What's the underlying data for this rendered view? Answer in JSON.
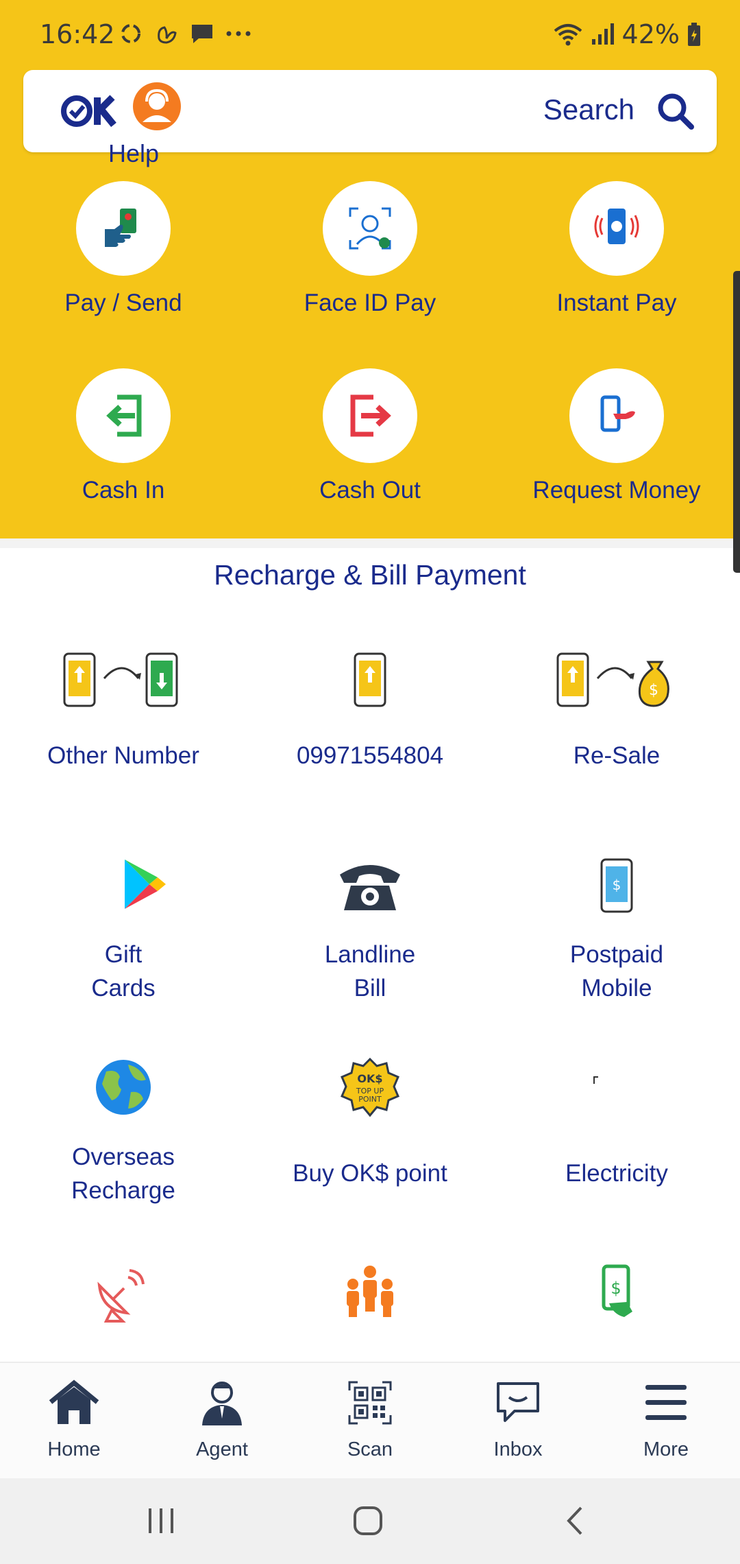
{
  "status_bar": {
    "time": "16:42",
    "battery": "42%"
  },
  "search_bar": {
    "search_label": "Search",
    "help_label": "Help"
  },
  "quick_actions": [
    {
      "label": "Pay / Send",
      "icon": "pay-send-icon"
    },
    {
      "label": "Face ID Pay",
      "icon": "face-id-icon"
    },
    {
      "label": "Instant Pay",
      "icon": "instant-pay-icon"
    },
    {
      "label": "Cash In",
      "icon": "cash-in-icon"
    },
    {
      "label": "Cash Out",
      "icon": "cash-out-icon"
    },
    {
      "label": "Request Money",
      "icon": "request-money-icon"
    }
  ],
  "recharge": {
    "title": "Recharge & Bill Payment",
    "items": [
      {
        "label": "Other Number",
        "icon": "other-number-icon"
      },
      {
        "label": "09971554804",
        "icon": "own-number-icon"
      },
      {
        "label": "Re-Sale",
        "icon": "resale-icon"
      },
      {
        "label": "Gift\nCards",
        "icon": "play-store-icon"
      },
      {
        "label": "Landline\nBill",
        "icon": "telephone-icon"
      },
      {
        "label": "Postpaid\nMobile",
        "icon": "postpaid-mobile-icon"
      },
      {
        "label": "Overseas\nRecharge",
        "icon": "globe-icon"
      },
      {
        "label": "Buy OK$ point",
        "icon": "topup-point-icon",
        "badge_text": "OK$ TOP UP POINT"
      },
      {
        "label": "Electricity",
        "icon": "electricity-icon"
      },
      {
        "label": "",
        "icon": "satellite-dish-icon"
      },
      {
        "label": "",
        "icon": "group-icon"
      },
      {
        "label": "",
        "icon": "merchant-pay-icon"
      }
    ]
  },
  "bottom_nav": [
    {
      "label": "Home",
      "icon": "home-icon"
    },
    {
      "label": "Agent",
      "icon": "agent-icon"
    },
    {
      "label": "Scan",
      "icon": "qr-scan-icon"
    },
    {
      "label": "Inbox",
      "icon": "inbox-icon"
    },
    {
      "label": "More",
      "icon": "menu-icon"
    }
  ],
  "colors": {
    "brand_yellow": "#f5c518",
    "brand_blue": "#1a2b8c",
    "accent_orange": "#f47b20"
  }
}
